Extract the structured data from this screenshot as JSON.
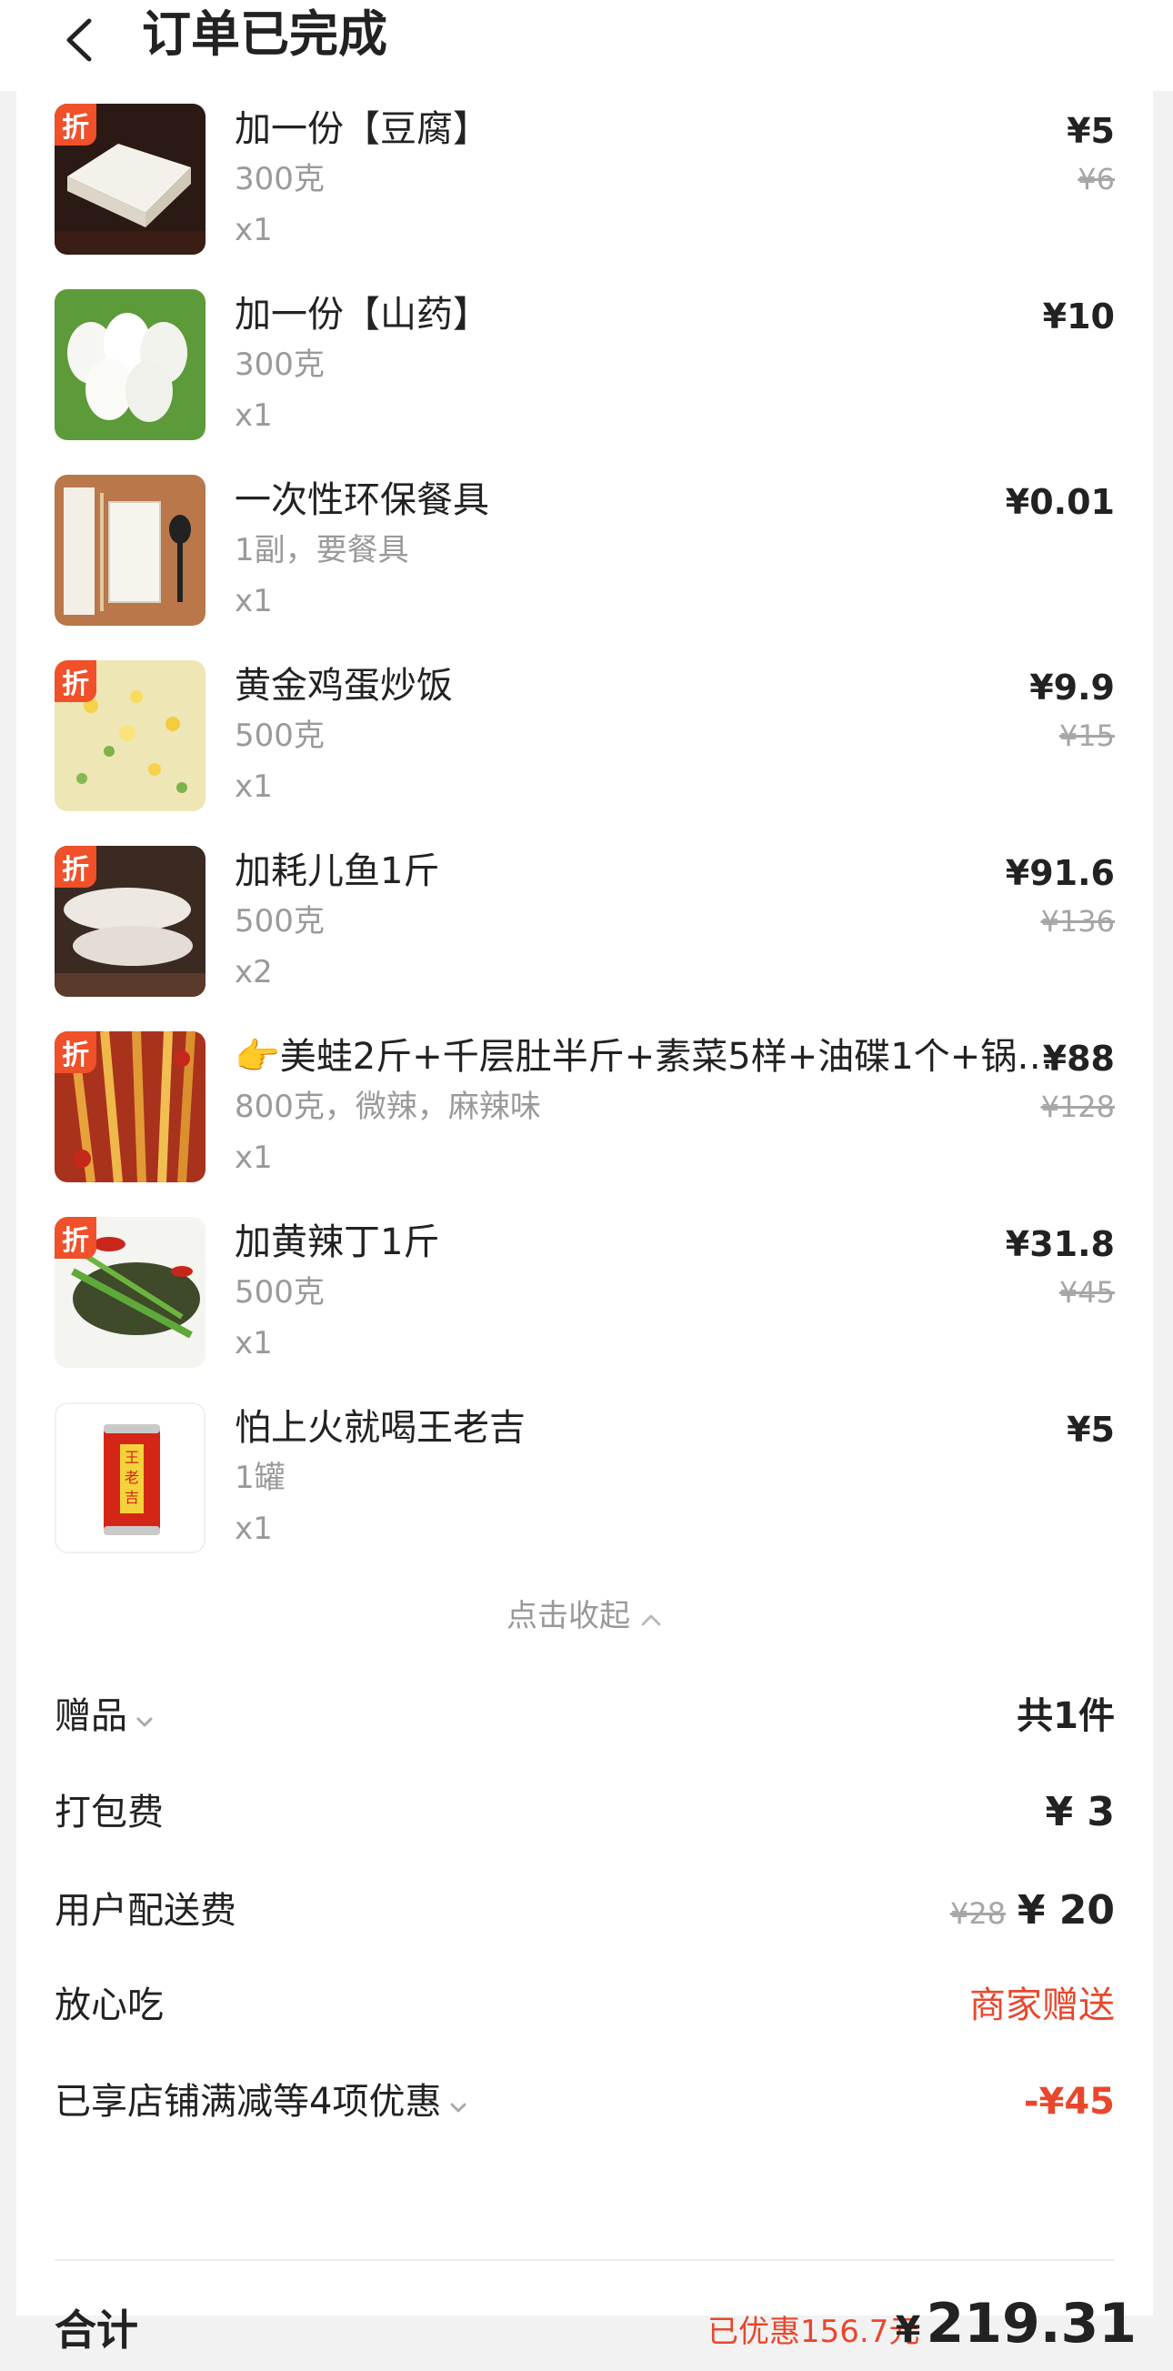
{
  "header": {
    "title": "订单已完成"
  },
  "items": [
    {
      "name": "加一份【豆腐】",
      "spec": "300克",
      "qty": "x1",
      "price": "¥5",
      "orig": "¥6",
      "discount": true,
      "badge": "折"
    },
    {
      "name": "加一份【山药】",
      "spec": "300克",
      "qty": "x1",
      "price": "¥10",
      "orig": "",
      "discount": false,
      "badge": ""
    },
    {
      "name": "一次性环保餐具",
      "spec": "1副，要餐具",
      "qty": "x1",
      "price": "¥0.01",
      "orig": "",
      "discount": false,
      "badge": ""
    },
    {
      "name": "黄金鸡蛋炒饭",
      "spec": "500克",
      "qty": "x1",
      "price": "¥9.9",
      "orig": "¥15",
      "discount": true,
      "badge": "折"
    },
    {
      "name": "加耗儿鱼1斤",
      "spec": "500克",
      "qty": "x2",
      "price": "¥91.6",
      "orig": "¥136",
      "discount": true,
      "badge": "折"
    },
    {
      "name": "👉美蛙2斤+千层肚半斤+素菜5样+油碟1个+锅…",
      "spec": "800克，微辣，麻辣味",
      "qty": "x1",
      "price": "¥88",
      "orig": "¥128",
      "discount": true,
      "badge": "折"
    },
    {
      "name": "加黄辣丁1斤",
      "spec": "500克",
      "qty": "x1",
      "price": "¥31.8",
      "orig": "¥45",
      "discount": true,
      "badge": "折"
    },
    {
      "name": "怕上火就喝王老吉",
      "spec": "1罐",
      "qty": "x1",
      "price": "¥5",
      "orig": "",
      "discount": false,
      "badge": "",
      "can_text": "王老吉"
    }
  ],
  "collapse_label": "点击收起",
  "fees": {
    "gift_label": "赠品",
    "gift_value": "共1件",
    "packing_label": "打包费",
    "packing_value": "¥ 3",
    "delivery_label": "用户配送费",
    "delivery_orig": "¥28",
    "delivery_value": "¥ 20",
    "worry_label": "放心吃",
    "worry_value": "商家赠送",
    "discount_label": "已享店铺满减等4项优惠",
    "discount_value": "-¥45"
  },
  "total": {
    "label": "合计",
    "saved": "已优惠156.7元",
    "currency": "¥",
    "amount": "219.31"
  },
  "colors": {
    "accent": "#e8472d",
    "badge": "#f0502a"
  }
}
